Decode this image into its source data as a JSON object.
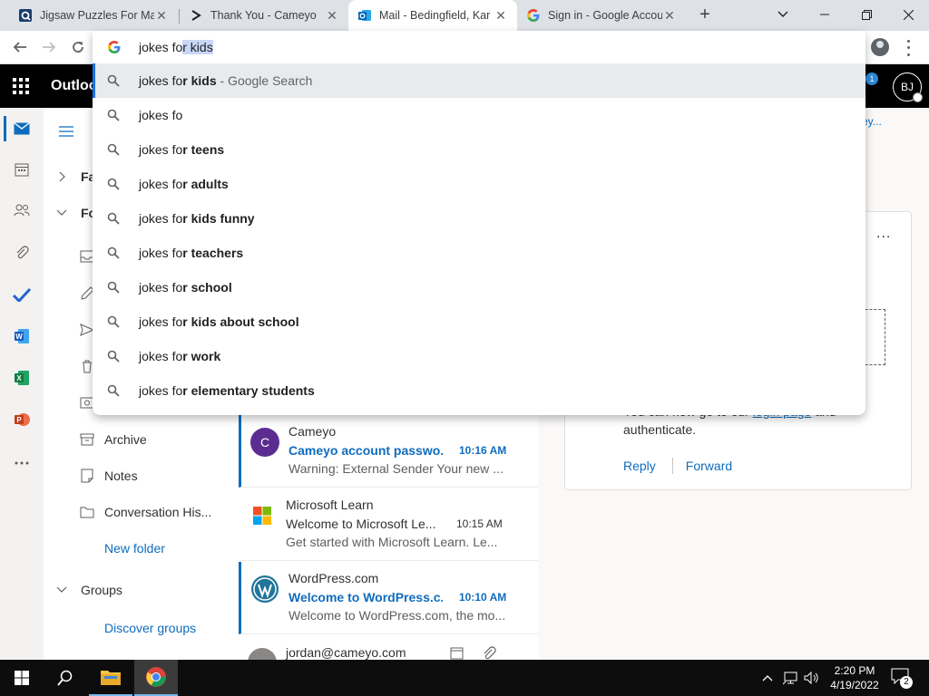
{
  "browser": {
    "tabs": [
      {
        "title": "Jigsaw Puzzles For Mac",
        "icon": "jigsaw-favicon"
      },
      {
        "title": "Thank You - Cameyo",
        "icon": "cameyo-favicon"
      },
      {
        "title": "Mail - Bedingfield, Kar",
        "icon": "outlook-favicon",
        "active": true
      },
      {
        "title": "Sign in - Google Accou",
        "icon": "google-favicon"
      }
    ],
    "new_tab": "+",
    "close_glyph": "✕"
  },
  "omnibox": {
    "typed": "jokes fo",
    "autocomplete": "r kids",
    "suggestions": [
      {
        "prefix": "jokes fo",
        "bold": "r kids",
        "hint": " - Google Search"
      },
      {
        "prefix": "jokes fo",
        "bold": "",
        "hint": ""
      },
      {
        "prefix": "jokes fo",
        "bold": "r teens",
        "hint": ""
      },
      {
        "prefix": "jokes fo",
        "bold": "r adults",
        "hint": ""
      },
      {
        "prefix": "jokes fo",
        "bold": "r kids funny",
        "hint": ""
      },
      {
        "prefix": "jokes fo",
        "bold": "r teachers",
        "hint": ""
      },
      {
        "prefix": "jokes fo",
        "bold": "r school",
        "hint": ""
      },
      {
        "prefix": "jokes fo",
        "bold": "r kids about school",
        "hint": ""
      },
      {
        "prefix": "jokes fo",
        "bold": "r work",
        "hint": ""
      },
      {
        "prefix": "jokes fo",
        "bold": "r elementary students",
        "hint": ""
      }
    ]
  },
  "outlook": {
    "brand": "Outlook",
    "notification_count": "1",
    "avatar_initials": "BJ",
    "top_link": "ey...",
    "folders_partial": {
      "favorites": "Fa",
      "folders": "Fo"
    },
    "folders": [
      {
        "label": "Archive",
        "icon": "archive-icon"
      },
      {
        "label": "Notes",
        "icon": "notes-icon"
      },
      {
        "label": "Conversation His...",
        "icon": "folder-icon"
      }
    ],
    "new_folder": "New folder",
    "groups": "Groups",
    "discover_groups": "Discover groups",
    "messages": [
      {
        "sender": "Cameyo",
        "subject": "Cameyo account passwo...",
        "time": "10:16 AM",
        "preview": "Warning: External Sender Your new ...",
        "unread": true,
        "avatar": "C",
        "avatar_color": "#5c2d91"
      },
      {
        "sender": "Microsoft Learn",
        "subject": "Welcome to Microsoft Le...",
        "time": "10:15 AM",
        "preview": "Get started with Microsoft Learn. Le...",
        "unread": false,
        "avatar": "",
        "avatar_color": ""
      },
      {
        "sender": "WordPress.com",
        "subject": "Welcome to WordPress.c...",
        "time": "10:10 AM",
        "preview": "Welcome to WordPress.com, the mo...",
        "unread": true,
        "avatar": "",
        "avatar_color": "#21759b"
      },
      {
        "sender": "jordan@cameyo.com",
        "subject": "",
        "time": "",
        "preview": "",
        "unread": false,
        "avatar": "",
        "avatar_color": "#8a8886"
      }
    ],
    "reading": {
      "line1_pre": "You can now go to our ",
      "line1_link": "login page",
      "line1_post": " and",
      "line2": "authenticate.",
      "reply": "Reply",
      "forward": "Forward",
      "more": "..."
    }
  },
  "taskbar": {
    "time": "2:20 PM",
    "date": "4/19/2022",
    "notification_count": "2"
  }
}
